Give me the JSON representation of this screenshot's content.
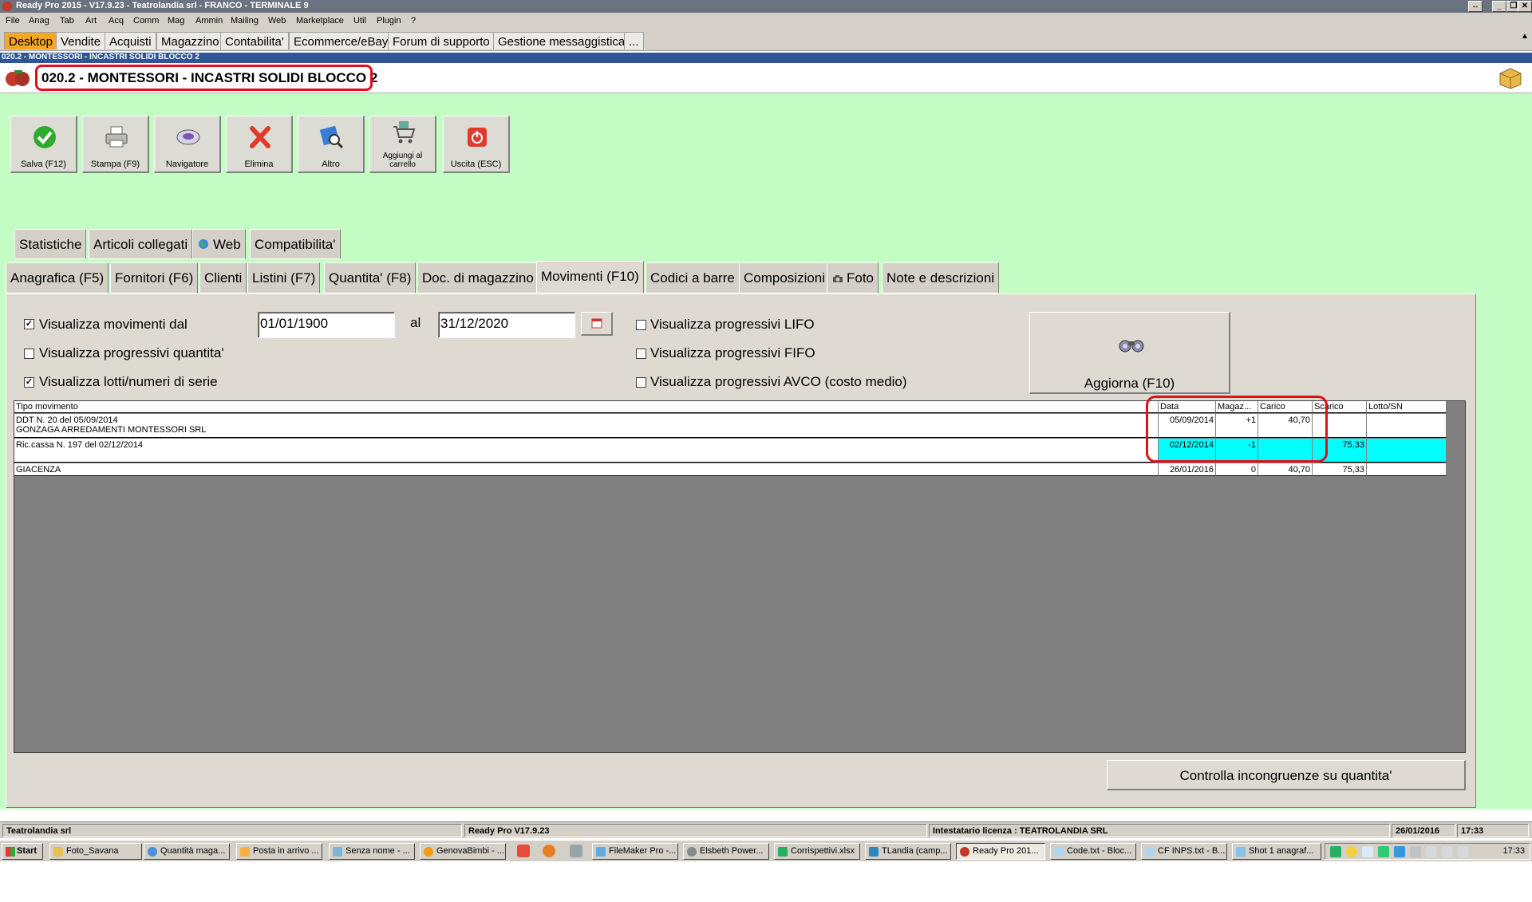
{
  "window": {
    "title": "Ready Pro 2015 - V17.9.23 - Teatrolandia srl - FRANCO - TERMINALE 9"
  },
  "menu": [
    "File",
    "Anag",
    "Tab",
    "Art",
    "Acq",
    "Comm",
    "Mag",
    "Ammin",
    "Mailing",
    "Web",
    "Marketplace",
    "Util",
    "Plugin",
    "?"
  ],
  "desktop_tabs": [
    "Desktop",
    "Vendite",
    "Acquisti",
    "Magazzino",
    "Contabilita'",
    "Ecommerce/eBay",
    "Forum di supporto",
    "Gestione messaggistica",
    "..."
  ],
  "doc_strip": "020.2 - MONTESSORI - INCASTRI SOLIDI BLOCCO 2",
  "page_title": "020.2 - MONTESSORI - INCASTRI SOLIDI BLOCCO 2",
  "toolbar": {
    "save": "Salva (F12)",
    "print": "Stampa (F9)",
    "navigator": "Navigatore",
    "delete": "Elimina",
    "other": "Altro",
    "cart_line1": "Aggiungi al",
    "cart_line2": "carrello",
    "exit": "Uscita (ESC)"
  },
  "tabs_row1": [
    "Statistiche",
    "Articoli collegati",
    "Web",
    "Compatibilita'"
  ],
  "tabs_row2": [
    "Anagrafica (F5)",
    "Fornitori (F6)",
    "Clienti",
    "Listini (F7)",
    "Quantita' (F8)",
    "Doc. di magazzino",
    "Movimenti (F10)",
    "Codici a barre",
    "Composizioni",
    "Foto",
    "Note e descrizioni"
  ],
  "active_tab": "Movimenti (F10)",
  "filters": {
    "show_movements": {
      "label": "Visualizza movimenti dal",
      "checked": true
    },
    "date_from": "01/01/1900",
    "date_sep": "al",
    "date_to": "31/12/2020",
    "show_qty_progressive": {
      "label": "Visualizza progressivi quantita'",
      "checked": false
    },
    "show_lots": {
      "label": "Visualizza lotti/numeri di serie",
      "checked": true
    },
    "show_lifo": {
      "label": "Visualizza progressivi LIFO",
      "checked": false
    },
    "show_fifo": {
      "label": "Visualizza progressivi FIFO",
      "checked": false
    },
    "show_avco": {
      "label": "Visualizza progressivi AVCO (costo medio)",
      "checked": false
    },
    "check_mark": "✓"
  },
  "refresh_button": "Aggiorna (F10)",
  "grid": {
    "columns": [
      "Tipo movimento",
      "Data",
      "Magaz...",
      "Carico",
      "Scarico",
      "Lotto/SN"
    ],
    "rows": [
      {
        "tipo_line1": "DDT N. 20 del 05/09/2014",
        "tipo_line2": "GONZAGA ARREDAMENTI MONTESSORI SRL",
        "data": "05/09/2014",
        "magaz": "+1",
        "carico": "40,70",
        "scarico": "",
        "lotto": ""
      },
      {
        "tipo_line1": "Ric.cassa N. 197 del 02/12/2014",
        "tipo_line2": "",
        "data": "02/12/2014",
        "magaz": "-1",
        "carico": "",
        "scarico": "75,33",
        "lotto": ""
      },
      {
        "tipo_line1": "GIACENZA",
        "tipo_line2": "",
        "data": "26/01/2016",
        "magaz": "0",
        "carico": "40,70",
        "scarico": "75,33",
        "lotto": ""
      }
    ]
  },
  "check_button": "Controlla incongruenze su quantita'",
  "status": {
    "company": "Teatrolandia srl",
    "version": "Ready Pro V17.9.23",
    "license": "Intestatario licenza : TEATROLANDIA SRL",
    "date": "26/01/2016",
    "time": "17:33"
  },
  "taskbar": {
    "start": "Start",
    "tasks": [
      "Foto_Savana",
      "Quantità maga...",
      "Posta in arrivo ...",
      "Senza nome - ...",
      "GenovaBimbi - ...",
      "FileMaker Pro -...",
      "Elsbeth Power...",
      "Corrispettivi.xlsx",
      "TLandia (camp...",
      "Ready Pro 201...",
      "Code.txt - Bloc...",
      "CF INPS.txt - B...",
      "Shot 1 anagraf..."
    ],
    "clock": "17:33"
  },
  "colors": {
    "form_bg": "#c3fdc3",
    "active_desktop_tab": "#f5a623",
    "highlight_row": "#00ffff",
    "annotation_red": "#e0101a"
  }
}
